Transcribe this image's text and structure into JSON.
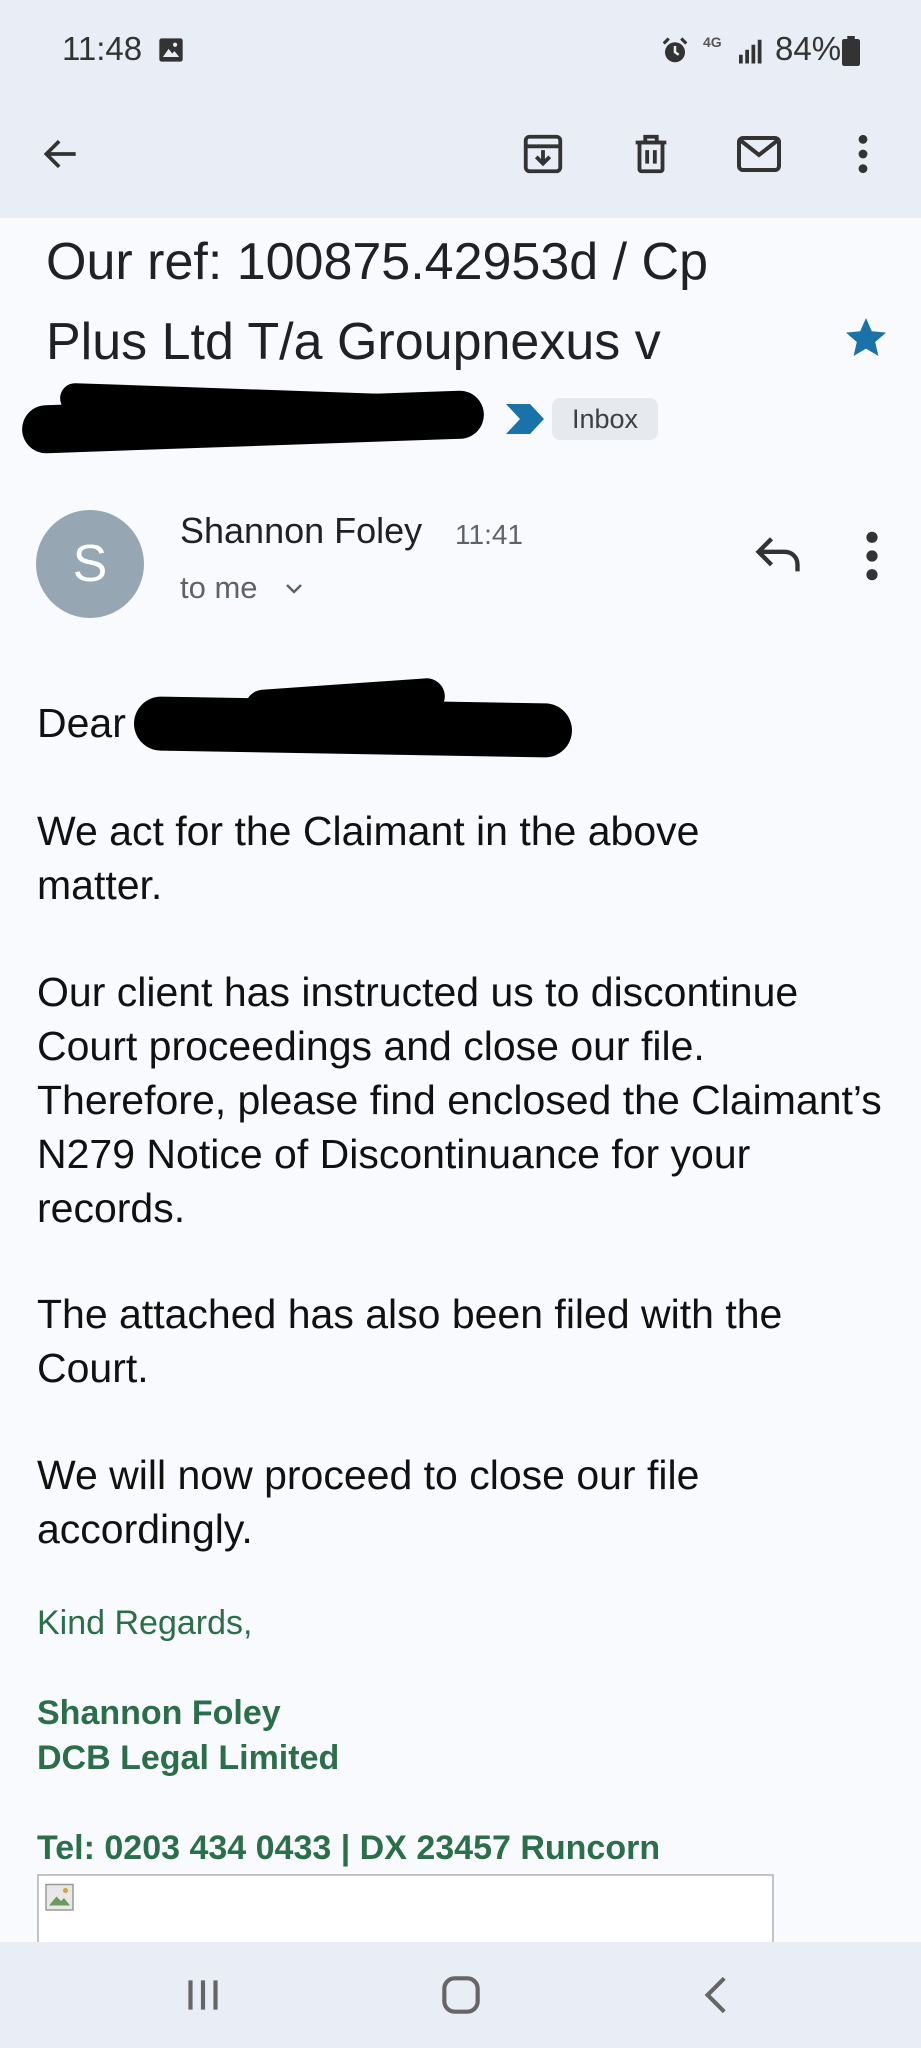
{
  "status_bar": {
    "time": "11:48",
    "network": "4G",
    "battery_percent": "84%",
    "icons": [
      "image-icon",
      "alarm-icon",
      "signal-icon",
      "battery-icon"
    ]
  },
  "toolbar": {
    "icons": [
      "back-arrow-icon",
      "archive-icon",
      "delete-icon",
      "mark-unread-icon",
      "more-vert-icon"
    ]
  },
  "email": {
    "subject_line1": "Our ref: 100875.42953d / Cp",
    "subject_line2": "Plus Ltd T/a Groupnexus v",
    "starred": true,
    "label": "Inbox",
    "sender": {
      "initial": "S",
      "name": "Shannon Foley",
      "time": "11:41",
      "recipient": "to me"
    },
    "body": {
      "greeting": "Dear",
      "p1": "We act for the Claimant in the above matter.",
      "p2": "Our client has instructed us to discontinue Court proceedings and close our file. Therefore, please find enclosed the Claimant’s N279 Notice of Discontinuance for your records.",
      "p3": "The attached has also been filed with the Court.",
      "p4": "We will now proceed to close our file accordingly."
    },
    "signature": {
      "closing": "Kind Regards,",
      "name": "Shannon Foley",
      "company": "DCB Legal Limited",
      "contact": "Tel: 0203 434 0433 | DX 23457 Runcorn"
    }
  },
  "colors": {
    "header_bg": "#e8edf6",
    "star": "#1a73a8",
    "signature": "#2b6e4a",
    "avatar": "#96a6b2"
  },
  "nav_bar": {
    "icons": [
      "recent-apps-icon",
      "home-icon",
      "back-icon"
    ]
  }
}
